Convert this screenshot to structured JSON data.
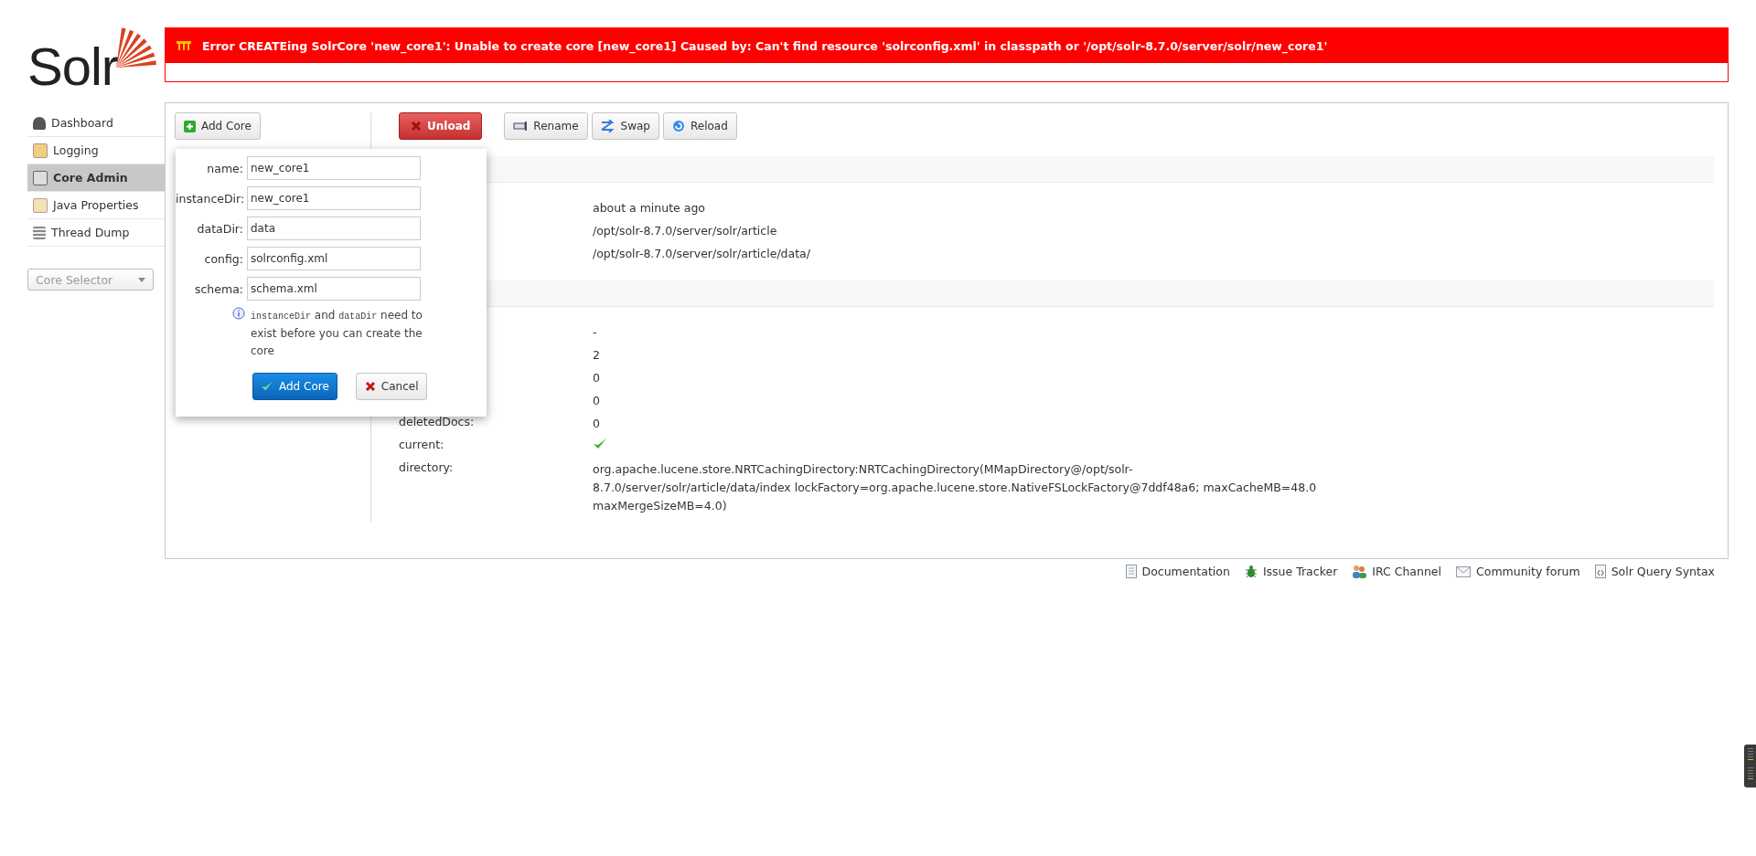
{
  "logo": {
    "text": "Solr"
  },
  "error": {
    "message": "Error CREATEing SolrCore 'new_core1': Unable to create core [new_core1] Caused by: Can't find resource 'solrconfig.xml' in classpath or '/opt/solr-8.7.0/server/solr/new_core1'"
  },
  "nav": [
    {
      "label": "Dashboard",
      "kind": "dashboard",
      "selected": false
    },
    {
      "label": "Logging",
      "kind": "logging",
      "selected": false
    },
    {
      "label": "Core Admin",
      "kind": "cores",
      "selected": true
    },
    {
      "label": "Java Properties",
      "kind": "java",
      "selected": false
    },
    {
      "label": "Thread Dump",
      "kind": "threads",
      "selected": false
    }
  ],
  "core_selector": {
    "placeholder": "Core Selector"
  },
  "add_core_button": "Add Core",
  "actions": [
    {
      "label": "Unload",
      "kind": "unload"
    },
    {
      "label": "Rename",
      "kind": "rename"
    },
    {
      "label": "Swap",
      "kind": "swap"
    },
    {
      "label": "Reload",
      "kind": "reload"
    }
  ],
  "sections": [
    {
      "rows": [
        {
          "value": "about a minute ago"
        },
        {
          "value": "/opt/solr-8.7.0/server/solr/article"
        },
        {
          "value": "/opt/solr-8.7.0/server/solr/article/data/"
        }
      ]
    },
    {
      "rows": [
        {
          "value": "-"
        },
        {
          "value": "2"
        },
        {
          "value": "0"
        },
        {
          "value": "0"
        },
        {
          "label": "deletedDocs:",
          "value": "0"
        },
        {
          "label": "current:",
          "checked": true
        },
        {
          "label": "directory:",
          "value": "org.apache.lucene.store.NRTCachingDirectory:NRTCachingDirectory(MMapDirectory@/opt/solr-8.7.0/server/solr/article/data/index lockFactory=org.apache.lucene.store.NativeFSLockFactory@7ddf48a6; maxCacheMB=48.0 maxMergeSizeMB=4.0)"
        }
      ]
    }
  ],
  "dialog": {
    "fields": [
      {
        "label": "name:",
        "value": "new_core1"
      },
      {
        "label": "instanceDir:",
        "value": "new_core1"
      },
      {
        "label": "dataDir:",
        "value": "data"
      },
      {
        "label": "config:",
        "value": "solrconfig.xml"
      },
      {
        "label": "schema:",
        "value": "schema.xml"
      }
    ],
    "note": [
      {
        "text": "instanceDir",
        "code": true
      },
      {
        "text": " and ",
        "code": false
      },
      {
        "text": "dataDir",
        "code": true
      },
      {
        "text": " need to exist before you can create the core",
        "code": false
      }
    ],
    "confirm": "Add Core",
    "cancel": "Cancel"
  },
  "footer": [
    {
      "label": "Documentation",
      "kind": "doc"
    },
    {
      "label": "Issue Tracker",
      "kind": "bug"
    },
    {
      "label": "IRC Channel",
      "kind": "irc"
    },
    {
      "label": "Community forum",
      "kind": "mail"
    },
    {
      "label": "Solr Query Syntax",
      "kind": "query"
    }
  ]
}
